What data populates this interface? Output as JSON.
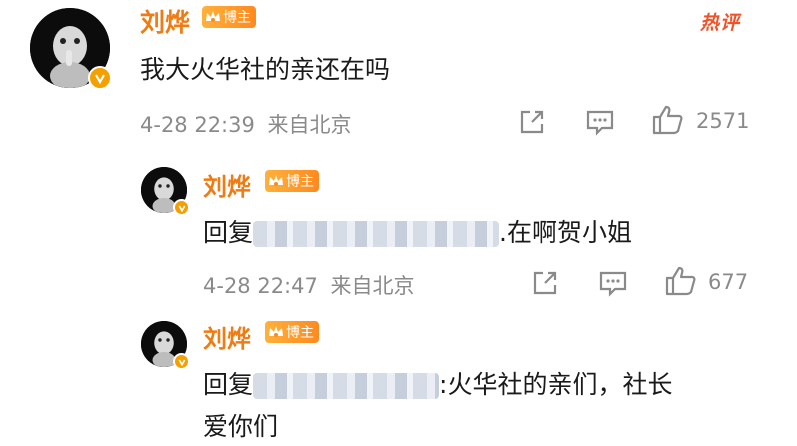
{
  "hot_label": "热评",
  "comments": [
    {
      "author": "刘烨",
      "badge": "博主",
      "text": "我大火华社的亲还在吗",
      "time": "4-28 22:39",
      "source": "来自北京",
      "likes": "2571"
    },
    {
      "author": "刘烨",
      "badge": "博主",
      "reply_prefix": "回复",
      "text": ".在啊贺小姐",
      "time": "4-28 22:47",
      "source": "来自北京",
      "likes": "677"
    },
    {
      "author": "刘烨",
      "badge": "博主",
      "reply_prefix": "回复",
      "text_line1": ":火华社的亲们，社长",
      "text_line2": "爱你们"
    }
  ],
  "colors": {
    "name": "#f07b12",
    "badge": "#ff9a2e",
    "hot": "#f0532a",
    "meta": "#8a8a8a"
  },
  "icons": [
    "share-icon",
    "comment-icon",
    "like-icon",
    "verified-icon",
    "crown-icon"
  ]
}
